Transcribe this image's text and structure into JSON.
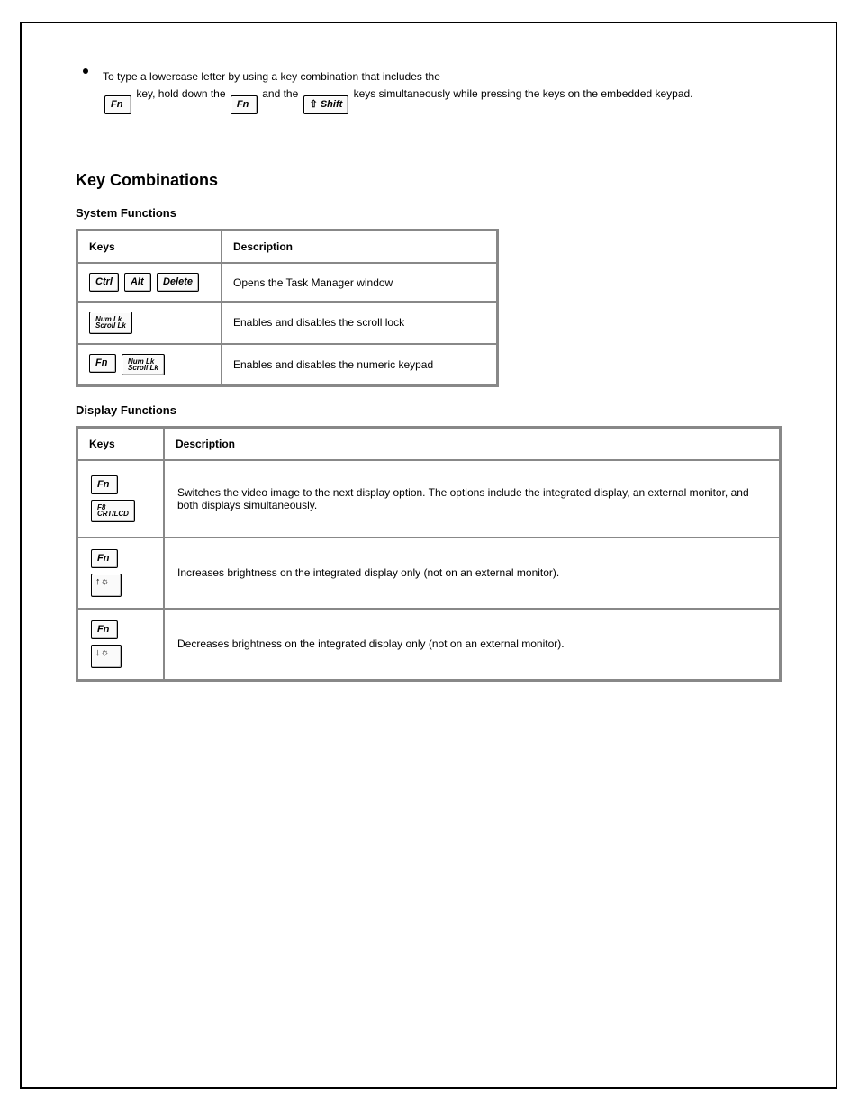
{
  "bullet": {
    "line1_pre": "To type a lowercase letter by using a key combination that includes the",
    "line2_pre": " key, hold down the",
    "line2_mid": " and the",
    "line2_post": " keys simultaneously while pressing the keys on the embedded keypad."
  },
  "keys": {
    "fn": "Fn",
    "shift": "Shift",
    "ctrl": "Ctrl",
    "alt": "Alt",
    "delete": "Delete",
    "numlk_top": "Num Lk",
    "numlk_bot": "Scroll Lk",
    "f8_top": "F8",
    "f8_bot": "CRT/LCD"
  },
  "sections": {
    "combos_title": "Key Combinations",
    "system_sub": "System Functions",
    "display_sub": "Display Functions"
  },
  "tables": {
    "headers": {
      "keys": "Keys",
      "desc": "Description"
    },
    "system": [
      {
        "desc": "Opens the Task Manager window"
      },
      {
        "desc": "Enables and disables the scroll lock"
      },
      {
        "desc": "Enables and disables the numeric keypad"
      }
    ],
    "display": [
      {
        "desc": "Switches the video image to the next display option. The options include the integrated display, an external monitor, and both displays simultaneously."
      },
      {
        "desc": "Increases brightness on the integrated display only (not on an external monitor)."
      },
      {
        "desc": "Decreases brightness on the integrated display only (not on an external monitor)."
      }
    ]
  }
}
